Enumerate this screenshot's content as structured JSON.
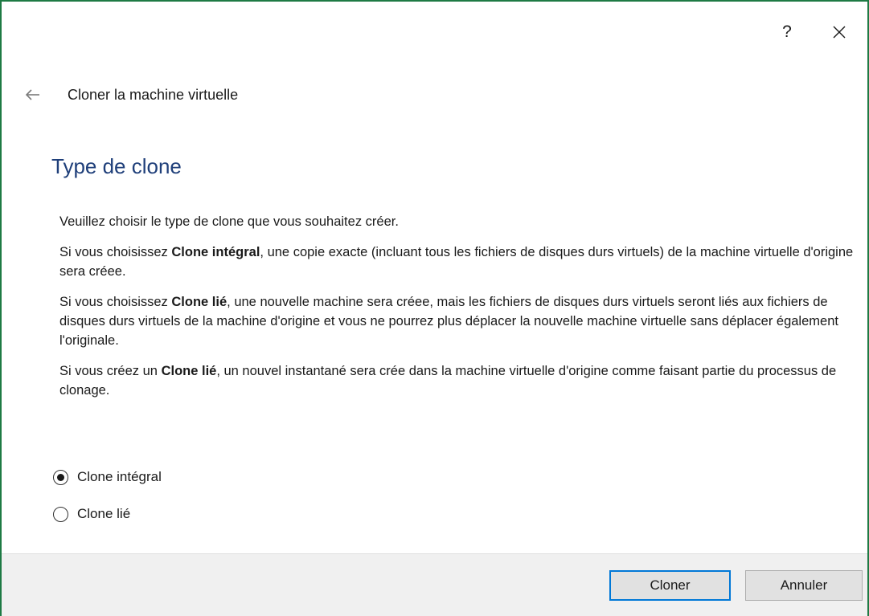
{
  "titlebar": {
    "help_label": "?"
  },
  "nav": {
    "title": "Cloner la machine virtuelle"
  },
  "page": {
    "heading": "Type de clone",
    "intro": "Veuillez choisir le type de clone que vous souhaitez créer.",
    "full_clone_para": {
      "prefix": "Si vous choisissez ",
      "bold": "Clone intégral",
      "suffix": ", une copie exacte (incluant tous les fichiers de disques durs virtuels) de la machine virtuelle d'origine sera créee."
    },
    "linked_clone_para": {
      "prefix": "Si vous choisissez ",
      "bold": "Clone lié",
      "suffix": ", une nouvelle machine sera créee, mais les fichiers de disques durs virtuels seront liés aux fichiers de disques durs virtuels de la machine d'origine et vous ne pourrez plus déplacer la nouvelle machine virtuelle sans déplacer également l'originale."
    },
    "snapshot_para": {
      "prefix": "Si vous créez un ",
      "bold": "Clone lié",
      "suffix": ", un nouvel instantané sera crée dans la machine virtuelle d'origine comme faisant partie du processus de clonage."
    }
  },
  "options": {
    "full_clone": {
      "label": "Clone intégral",
      "selected": true
    },
    "linked_clone": {
      "label": "Clone lié",
      "selected": false
    }
  },
  "footer": {
    "clone_button": "Cloner",
    "cancel_button": "Annuler"
  },
  "colors": {
    "heading": "#1f3f7a",
    "window_border": "#1e7a44",
    "default_button_border": "#0078d7"
  },
  "icons": {
    "close": "close-icon",
    "back": "back-arrow-icon"
  }
}
